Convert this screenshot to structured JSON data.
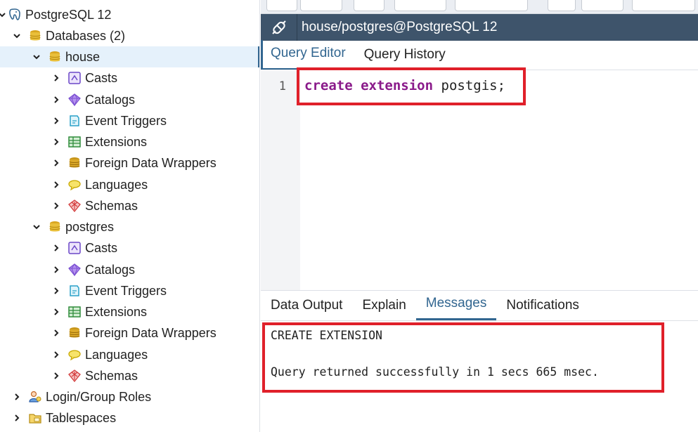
{
  "tree": {
    "items": [
      {
        "label": "PostgreSQL 12",
        "icon": "postgresql-elephant-icon",
        "expanded": true
      },
      {
        "label": "Databases (2)",
        "icon": "databases-icon",
        "expanded": true
      },
      {
        "label": "house",
        "icon": "database-icon",
        "expanded": true,
        "selected": true
      },
      {
        "label": "Casts",
        "icon": "casts-icon"
      },
      {
        "label": "Catalogs",
        "icon": "catalogs-icon"
      },
      {
        "label": "Event Triggers",
        "icon": "event-triggers-icon"
      },
      {
        "label": "Extensions",
        "icon": "extensions-icon"
      },
      {
        "label": "Foreign Data Wrappers",
        "icon": "foreign-data-wrappers-icon"
      },
      {
        "label": "Languages",
        "icon": "languages-icon"
      },
      {
        "label": "Schemas",
        "icon": "schemas-icon"
      },
      {
        "label": "postgres",
        "icon": "database-icon",
        "expanded": true
      },
      {
        "label": "Casts",
        "icon": "casts-icon"
      },
      {
        "label": "Catalogs",
        "icon": "catalogs-icon"
      },
      {
        "label": "Event Triggers",
        "icon": "event-triggers-icon"
      },
      {
        "label": "Extensions",
        "icon": "extensions-icon"
      },
      {
        "label": "Foreign Data Wrappers",
        "icon": "foreign-data-wrappers-icon"
      },
      {
        "label": "Languages",
        "icon": "languages-icon"
      },
      {
        "label": "Schemas",
        "icon": "schemas-icon"
      },
      {
        "label": "Login/Group Roles",
        "icon": "login-roles-icon"
      },
      {
        "label": "Tablespaces",
        "icon": "tablespaces-icon"
      }
    ]
  },
  "connection": {
    "title": "house/postgres@PostgreSQL 12",
    "icon": "connection-plug-icon"
  },
  "editor_tabs": [
    "Query Editor",
    "Query History"
  ],
  "editor": {
    "line_number": "1",
    "tokens": {
      "kw1": "create",
      "kw2": "extension",
      "ident": "postgis;"
    }
  },
  "output_tabs": [
    "Data Output",
    "Explain",
    "Messages",
    "Notifications"
  ],
  "messages": {
    "line1": "CREATE EXTENSION",
    "line2": "Query returned successfully in 1 secs 665 msec."
  },
  "colors": {
    "accent": "#326690",
    "header_bar": "#3e546b",
    "highlight_box": "#e0202a",
    "keyword": "#8a1a8a",
    "selected_row": "#e5f1fb"
  }
}
